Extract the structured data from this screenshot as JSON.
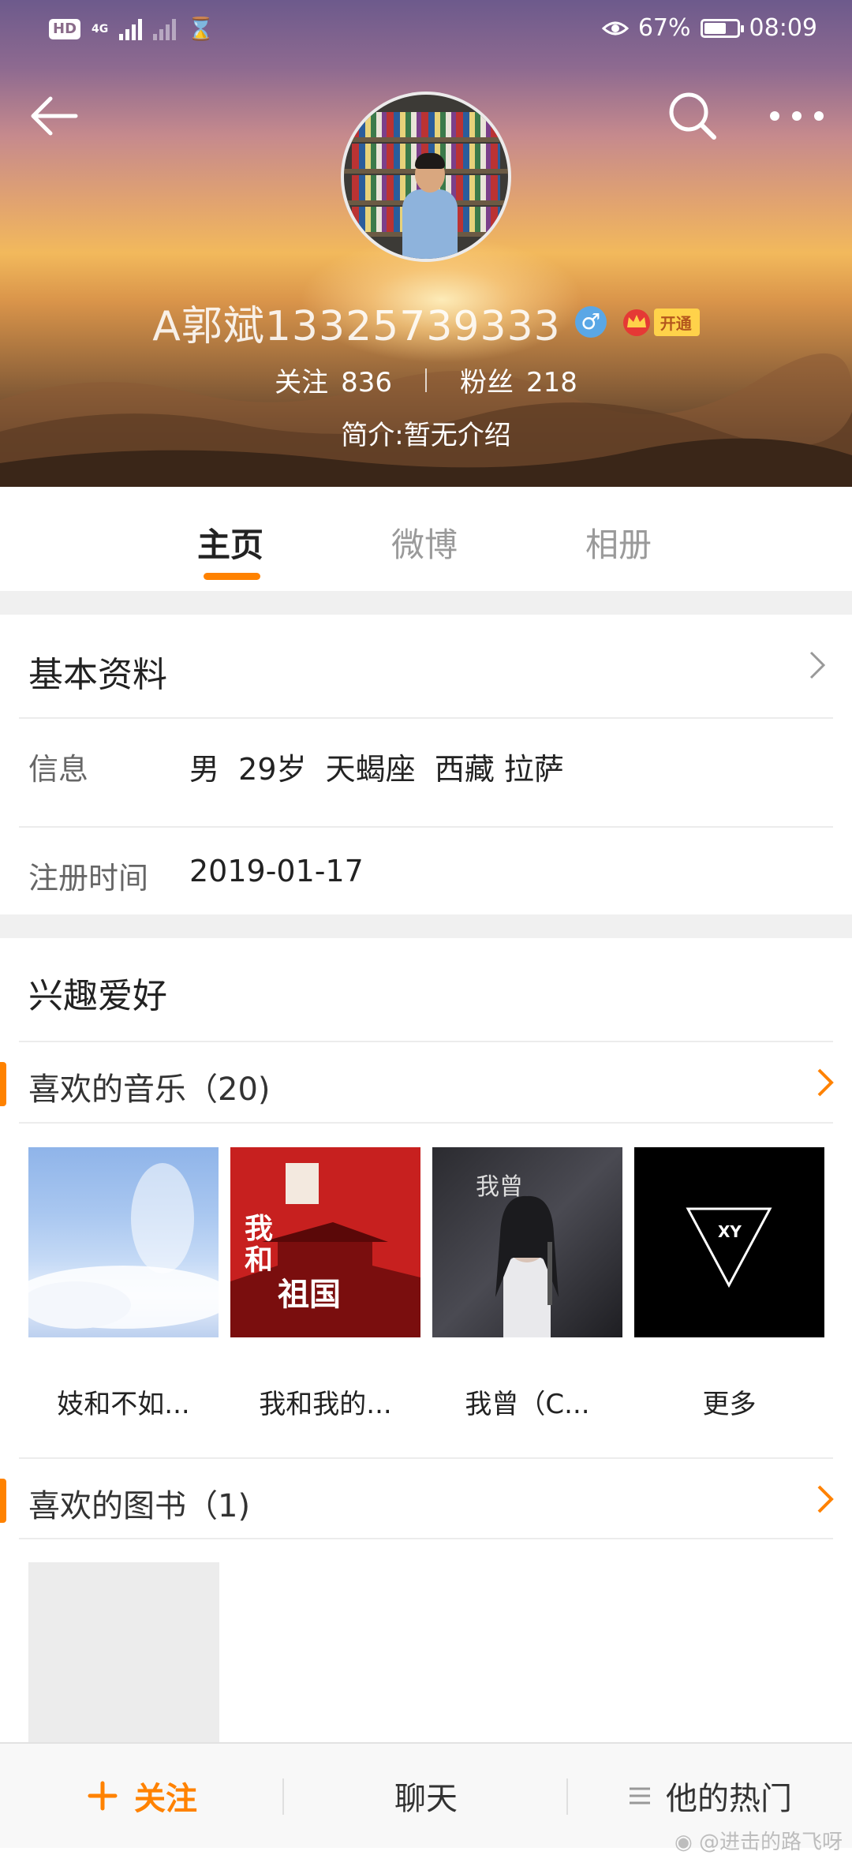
{
  "status_bar": {
    "hd": "HD",
    "network": "4G",
    "battery": "67%",
    "battery_level": 0.67,
    "time": "08:09"
  },
  "header": {
    "username": "A郭斌13325739333",
    "gender_symbol": "♂",
    "vip_label": "开通",
    "following_label": "关注",
    "following_count": "836",
    "fans_label": "粉丝",
    "fans_count": "218",
    "bio": "简介:暂无介绍"
  },
  "tabs": [
    {
      "label": "主页",
      "active": true
    },
    {
      "label": "微博",
      "active": false
    },
    {
      "label": "相册",
      "active": false
    }
  ],
  "basic_info": {
    "title": "基本资料",
    "rows": [
      {
        "label": "信息",
        "value": "男  29岁  天蝎座  西藏 拉萨"
      },
      {
        "label": "注册时间",
        "value": "2019-01-17"
      }
    ]
  },
  "interests": {
    "title": "兴趣爱好",
    "music": {
      "title": "喜欢的音乐（20)",
      "albums": [
        {
          "caption": "妓和不如..."
        },
        {
          "caption": "我和我的..."
        },
        {
          "caption": "我曾（C..."
        },
        {
          "caption": "更多"
        }
      ]
    },
    "books": {
      "title": "喜欢的图书（1)"
    }
  },
  "bottom_bar": {
    "follow": "关注",
    "chat": "聊天",
    "hot": "他的热门"
  },
  "watermark": "@进击的路飞呀",
  "colors": {
    "accent": "#ff8200",
    "tab_indicator": "#ff8200",
    "gender_badge": "#5aa7e6"
  }
}
